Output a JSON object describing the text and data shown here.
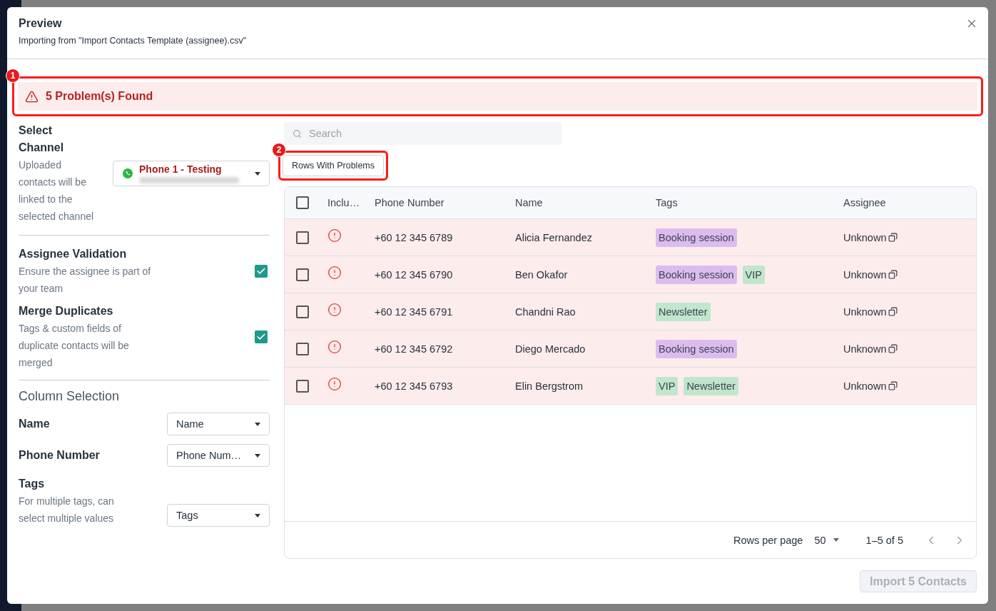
{
  "dialog": {
    "title": "Preview",
    "subtitle": "Importing from \"Import Contacts Template (assignee).csv\""
  },
  "alert": {
    "text": "5 Problem(s) Found",
    "annotation": "1"
  },
  "channel": {
    "title": "Select Channel",
    "description": "Uploaded contacts will be linked to the selected channel",
    "value": "Phone 1 - Testing"
  },
  "options": [
    {
      "title": "Assignee Validation",
      "description": "Ensure the assignee is part of your team",
      "checked": true
    },
    {
      "title": "Merge Duplicates",
      "description": "Tags & custom fields of duplicate contacts will be merged",
      "checked": true
    }
  ],
  "column_selection": {
    "title": "Column Selection",
    "fields": [
      {
        "label": "Name",
        "value": "Name"
      },
      {
        "label": "Phone Number",
        "value": "Phone Num…"
      },
      {
        "label": "Tags",
        "description": "For multiple tags, can select multiple values",
        "value": "Tags"
      }
    ]
  },
  "search": {
    "placeholder": "Search"
  },
  "filter_button": {
    "label": "Rows With Problems",
    "annotation": "2"
  },
  "table": {
    "columns": [
      "Inclu…",
      "Phone Number",
      "Name",
      "Tags",
      "Assignee"
    ],
    "all_selected": false,
    "rows": [
      {
        "selected": false,
        "problem": true,
        "phone": "+60 12 345 6789",
        "name": "Alicia Fernandez",
        "tags": [
          {
            "label": "Booking session",
            "color": "#dcbcef"
          }
        ],
        "assignee": "Unknown"
      },
      {
        "selected": false,
        "problem": true,
        "phone": "+60 12 345 6790",
        "name": "Ben Okafor",
        "tags": [
          {
            "label": "Booking session",
            "color": "#dcbcef"
          },
          {
            "label": "VIP",
            "color": "#c0e6cc"
          }
        ],
        "assignee": "Unknown"
      },
      {
        "selected": false,
        "problem": true,
        "phone": "+60 12 345 6791",
        "name": "Chandni Rao",
        "tags": [
          {
            "label": "Newsletter",
            "color": "#c0e6cc"
          }
        ],
        "assignee": "Unknown"
      },
      {
        "selected": false,
        "problem": true,
        "phone": "+60 12 345 6792",
        "name": "Diego Mercado",
        "tags": [
          {
            "label": "Booking session",
            "color": "#dcbcef"
          }
        ],
        "assignee": "Unknown"
      },
      {
        "selected": false,
        "problem": true,
        "phone": "+60 12 345 6793",
        "name": "Elin Bergstrom",
        "tags": [
          {
            "label": "VIP",
            "color": "#c0e6cc"
          },
          {
            "label": "Newsletter",
            "color": "#c0e6cc"
          }
        ],
        "assignee": "Unknown"
      }
    ]
  },
  "pagination": {
    "rows_label": "Rows per page",
    "rows_value": "50",
    "range": "1–5 of 5"
  },
  "import_button": {
    "label": "Import 5 Contacts",
    "disabled": true
  }
}
